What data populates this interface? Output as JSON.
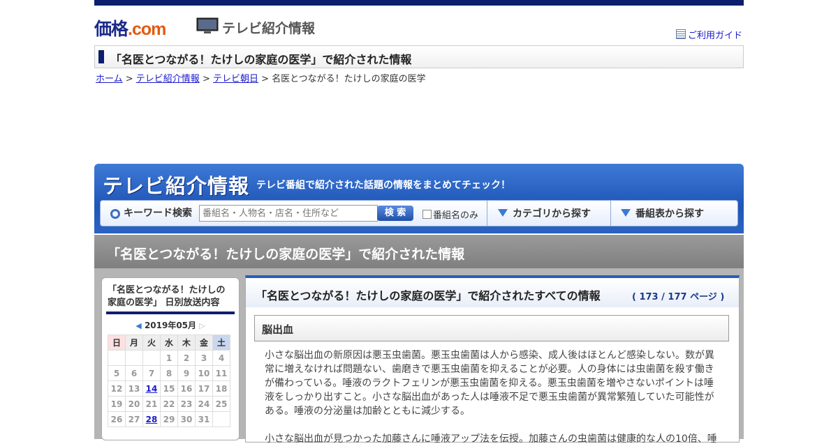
{
  "header": {
    "logo_main": "価格",
    "logo_dot": ".",
    "logo_com": "com",
    "section_title": "テレビ紹介情報",
    "guide_label": "ご利用ガイド"
  },
  "page_title": "「名医とつながる！たけしの家庭の医学」で紹介された情報",
  "breadcrumb": {
    "home": "ホーム",
    "sep1": " > ",
    "tv": "テレビ紹介情報",
    "sep2": " > ",
    "station": "テレビ朝日",
    "sep3": " > ",
    "current": "名医とつながる！たけしの家庭の医学"
  },
  "banner": {
    "title": "テレビ紹介情報",
    "subtitle": "テレビ番組で紹介された話題の情報をまとめてチェック！",
    "keyword_label": "キーワード検索",
    "search_placeholder": "番組名・人物名・店名・住所など",
    "search_button": "検 索",
    "program_only_label": "番組名のみ",
    "category_label": "カテゴリから探す",
    "schedule_label": "番組表から探す"
  },
  "section_header": "「名医とつながる！たけしの家庭の医学」で紹介された情報",
  "calendar": {
    "title": "「名医とつながる！たけしの家庭の医学」 日別放送内容",
    "prev": "◀",
    "month": "2019年05月",
    "next": "▷",
    "weekdays": [
      "日",
      "月",
      "火",
      "水",
      "木",
      "金",
      "土"
    ],
    "rows": [
      [
        "",
        "",
        "",
        "1",
        "2",
        "3",
        "4"
      ],
      [
        "5",
        "6",
        "7",
        "8",
        "9",
        "10",
        "11"
      ],
      [
        "12",
        "13",
        "14",
        "15",
        "16",
        "17",
        "18"
      ],
      [
        "19",
        "20",
        "21",
        "22",
        "23",
        "24",
        "25"
      ],
      [
        "26",
        "27",
        "28",
        "29",
        "30",
        "31",
        ""
      ]
    ],
    "linked_days": [
      "14",
      "28"
    ]
  },
  "content": {
    "heading": "「名医とつながる！たけしの家庭の医学」で紹介されたすべての情報",
    "page_info": "( 173 / 177 ページ )",
    "item_title": "脳出血",
    "item_desc": "小さな脳出血の新原因は悪玉虫歯菌。悪玉虫歯菌は人から感染、成人後はほとんど感染しない。数が異常に増えなければ問題ない、歯磨きで悪玉虫歯菌を抑えることが必要。人の身体には虫歯菌を殺す働きが備わっている。唾液のラクトフェリンが悪玉虫歯菌を抑える。悪玉虫歯菌を増やさないポイントは唾液をしっかり出すこと。小さな脳出血があった人は唾液不足で悪玉虫歯菌が異常繁殖していた可能性がある。唾液の分泌量は加齢とともに減少する。",
    "item_desc2": "小さな脳出血が見つかった加藤さんに唾液アップ法を伝授。加藤さんの虫歯菌は健康的な人の10倍、唾"
  },
  "colors": {
    "navy": "#0d1e6e",
    "link": "#1a1acc",
    "banner_blue": "#2c62c2"
  }
}
